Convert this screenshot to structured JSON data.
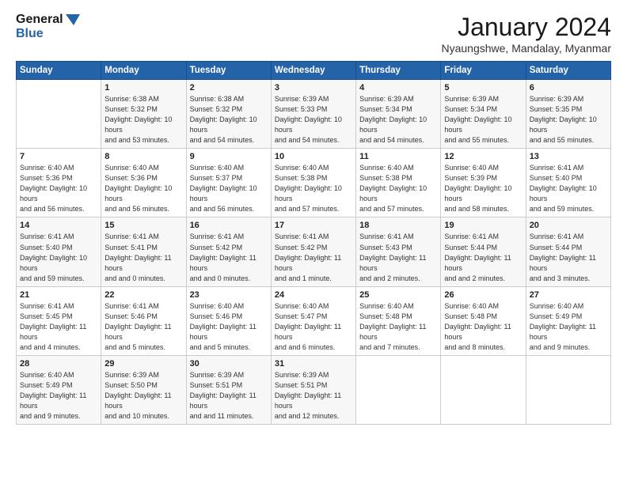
{
  "logo": {
    "line1": "General",
    "line2": "Blue"
  },
  "title": "January 2024",
  "location": "Nyaungshwe, Mandalay, Myanmar",
  "weekdays": [
    "Sunday",
    "Monday",
    "Tuesday",
    "Wednesday",
    "Thursday",
    "Friday",
    "Saturday"
  ],
  "weeks": [
    [
      {
        "day": "",
        "sunrise": "",
        "sunset": "",
        "daylight": ""
      },
      {
        "day": "1",
        "sunrise": "Sunrise: 6:38 AM",
        "sunset": "Sunset: 5:32 PM",
        "daylight": "Daylight: 10 hours and 53 minutes."
      },
      {
        "day": "2",
        "sunrise": "Sunrise: 6:38 AM",
        "sunset": "Sunset: 5:32 PM",
        "daylight": "Daylight: 10 hours and 54 minutes."
      },
      {
        "day": "3",
        "sunrise": "Sunrise: 6:39 AM",
        "sunset": "Sunset: 5:33 PM",
        "daylight": "Daylight: 10 hours and 54 minutes."
      },
      {
        "day": "4",
        "sunrise": "Sunrise: 6:39 AM",
        "sunset": "Sunset: 5:34 PM",
        "daylight": "Daylight: 10 hours and 54 minutes."
      },
      {
        "day": "5",
        "sunrise": "Sunrise: 6:39 AM",
        "sunset": "Sunset: 5:34 PM",
        "daylight": "Daylight: 10 hours and 55 minutes."
      },
      {
        "day": "6",
        "sunrise": "Sunrise: 6:39 AM",
        "sunset": "Sunset: 5:35 PM",
        "daylight": "Daylight: 10 hours and 55 minutes."
      }
    ],
    [
      {
        "day": "7",
        "sunrise": "Sunrise: 6:40 AM",
        "sunset": "Sunset: 5:36 PM",
        "daylight": "Daylight: 10 hours and 56 minutes."
      },
      {
        "day": "8",
        "sunrise": "Sunrise: 6:40 AM",
        "sunset": "Sunset: 5:36 PM",
        "daylight": "Daylight: 10 hours and 56 minutes."
      },
      {
        "day": "9",
        "sunrise": "Sunrise: 6:40 AM",
        "sunset": "Sunset: 5:37 PM",
        "daylight": "Daylight: 10 hours and 56 minutes."
      },
      {
        "day": "10",
        "sunrise": "Sunrise: 6:40 AM",
        "sunset": "Sunset: 5:38 PM",
        "daylight": "Daylight: 10 hours and 57 minutes."
      },
      {
        "day": "11",
        "sunrise": "Sunrise: 6:40 AM",
        "sunset": "Sunset: 5:38 PM",
        "daylight": "Daylight: 10 hours and 57 minutes."
      },
      {
        "day": "12",
        "sunrise": "Sunrise: 6:40 AM",
        "sunset": "Sunset: 5:39 PM",
        "daylight": "Daylight: 10 hours and 58 minutes."
      },
      {
        "day": "13",
        "sunrise": "Sunrise: 6:41 AM",
        "sunset": "Sunset: 5:40 PM",
        "daylight": "Daylight: 10 hours and 59 minutes."
      }
    ],
    [
      {
        "day": "14",
        "sunrise": "Sunrise: 6:41 AM",
        "sunset": "Sunset: 5:40 PM",
        "daylight": "Daylight: 10 hours and 59 minutes."
      },
      {
        "day": "15",
        "sunrise": "Sunrise: 6:41 AM",
        "sunset": "Sunset: 5:41 PM",
        "daylight": "Daylight: 11 hours and 0 minutes."
      },
      {
        "day": "16",
        "sunrise": "Sunrise: 6:41 AM",
        "sunset": "Sunset: 5:42 PM",
        "daylight": "Daylight: 11 hours and 0 minutes."
      },
      {
        "day": "17",
        "sunrise": "Sunrise: 6:41 AM",
        "sunset": "Sunset: 5:42 PM",
        "daylight": "Daylight: 11 hours and 1 minute."
      },
      {
        "day": "18",
        "sunrise": "Sunrise: 6:41 AM",
        "sunset": "Sunset: 5:43 PM",
        "daylight": "Daylight: 11 hours and 2 minutes."
      },
      {
        "day": "19",
        "sunrise": "Sunrise: 6:41 AM",
        "sunset": "Sunset: 5:44 PM",
        "daylight": "Daylight: 11 hours and 2 minutes."
      },
      {
        "day": "20",
        "sunrise": "Sunrise: 6:41 AM",
        "sunset": "Sunset: 5:44 PM",
        "daylight": "Daylight: 11 hours and 3 minutes."
      }
    ],
    [
      {
        "day": "21",
        "sunrise": "Sunrise: 6:41 AM",
        "sunset": "Sunset: 5:45 PM",
        "daylight": "Daylight: 11 hours and 4 minutes."
      },
      {
        "day": "22",
        "sunrise": "Sunrise: 6:41 AM",
        "sunset": "Sunset: 5:46 PM",
        "daylight": "Daylight: 11 hours and 5 minutes."
      },
      {
        "day": "23",
        "sunrise": "Sunrise: 6:40 AM",
        "sunset": "Sunset: 5:46 PM",
        "daylight": "Daylight: 11 hours and 5 minutes."
      },
      {
        "day": "24",
        "sunrise": "Sunrise: 6:40 AM",
        "sunset": "Sunset: 5:47 PM",
        "daylight": "Daylight: 11 hours and 6 minutes."
      },
      {
        "day": "25",
        "sunrise": "Sunrise: 6:40 AM",
        "sunset": "Sunset: 5:48 PM",
        "daylight": "Daylight: 11 hours and 7 minutes."
      },
      {
        "day": "26",
        "sunrise": "Sunrise: 6:40 AM",
        "sunset": "Sunset: 5:48 PM",
        "daylight": "Daylight: 11 hours and 8 minutes."
      },
      {
        "day": "27",
        "sunrise": "Sunrise: 6:40 AM",
        "sunset": "Sunset: 5:49 PM",
        "daylight": "Daylight: 11 hours and 9 minutes."
      }
    ],
    [
      {
        "day": "28",
        "sunrise": "Sunrise: 6:40 AM",
        "sunset": "Sunset: 5:49 PM",
        "daylight": "Daylight: 11 hours and 9 minutes."
      },
      {
        "day": "29",
        "sunrise": "Sunrise: 6:39 AM",
        "sunset": "Sunset: 5:50 PM",
        "daylight": "Daylight: 11 hours and 10 minutes."
      },
      {
        "day": "30",
        "sunrise": "Sunrise: 6:39 AM",
        "sunset": "Sunset: 5:51 PM",
        "daylight": "Daylight: 11 hours and 11 minutes."
      },
      {
        "day": "31",
        "sunrise": "Sunrise: 6:39 AM",
        "sunset": "Sunset: 5:51 PM",
        "daylight": "Daylight: 11 hours and 12 minutes."
      },
      {
        "day": "",
        "sunrise": "",
        "sunset": "",
        "daylight": ""
      },
      {
        "day": "",
        "sunrise": "",
        "sunset": "",
        "daylight": ""
      },
      {
        "day": "",
        "sunrise": "",
        "sunset": "",
        "daylight": ""
      }
    ]
  ]
}
